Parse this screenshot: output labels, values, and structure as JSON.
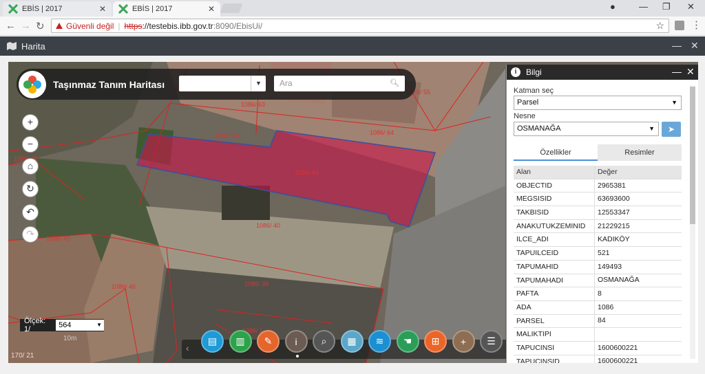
{
  "browser": {
    "tabs": [
      {
        "title": "EBİS | 2017"
      },
      {
        "title": "EBİS | 2017"
      }
    ],
    "security_label": "Güvenli değil",
    "url_scheme": "https",
    "url_host": "://testebis.ibb.gov.tr",
    "url_rest": ":8090/EbisUi/"
  },
  "app": {
    "header_title": "Harita",
    "map_title": "Taşınmaz Tanım Haritası",
    "search_placeholder": "Ara",
    "scale_label": "Ölçek: 1/",
    "scale_value": "564",
    "scale_unit": "10m",
    "copyright": "170/ 21"
  },
  "parcel_labels": [
    "1086/ 63",
    "1086/ 55",
    "1086/ 34",
    "1086/ 64",
    "1086/ 84",
    "1086/ 40",
    "1086/ 45",
    "1086/ 46",
    "1086/ 39",
    "1086/ 35",
    "1086/ 1"
  ],
  "toolbar_tools": [
    {
      "name": "document-tool",
      "color": "#1e9ad6"
    },
    {
      "name": "building-tool",
      "color": "#2ca24b"
    },
    {
      "name": "tag-tool",
      "color": "#e4662b"
    },
    {
      "name": "info-tool",
      "color": "#6b5b52"
    },
    {
      "name": "search-map-tool",
      "color": "#555555"
    },
    {
      "name": "map-tool",
      "color": "#5aa7c9"
    },
    {
      "name": "layers-tool",
      "color": "#1c8fd3"
    },
    {
      "name": "select-tool",
      "color": "#2a9e59"
    },
    {
      "name": "add-tool",
      "color": "#ec6528"
    },
    {
      "name": "crosshair-tool",
      "color": "#8e6e52"
    },
    {
      "name": "list-tool",
      "color": "#555555"
    }
  ],
  "info_panel": {
    "title": "Bilgi",
    "layer_label": "Katman seç",
    "layer_value": "Parsel",
    "object_label": "Nesne",
    "object_value": "OSMANAĞA",
    "tab_properties": "Özellikler",
    "tab_images": "Resimler",
    "col_field": "Alan",
    "col_value": "Değer",
    "rows": [
      {
        "k": "OBJECTID",
        "v": "2965381"
      },
      {
        "k": "MEGSISID",
        "v": "63693600"
      },
      {
        "k": "TAKBISID",
        "v": "12553347"
      },
      {
        "k": "ANAKUTUKZEMINID",
        "v": "21229215"
      },
      {
        "k": "ILCE_ADI",
        "v": "KADIKÖY"
      },
      {
        "k": "TAPUILCEID",
        "v": "521"
      },
      {
        "k": "TAPUMAHID",
        "v": "149493"
      },
      {
        "k": "TAPUMAHADI",
        "v": "OSMANAĞA"
      },
      {
        "k": "PAFTA",
        "v": "8"
      },
      {
        "k": "ADA",
        "v": "1086"
      },
      {
        "k": "PARSEL",
        "v": "84"
      },
      {
        "k": "MALIKTIPI",
        "v": ""
      },
      {
        "k": "TAPUCINSI",
        "v": "1600600221"
      },
      {
        "k": "TAPUCINSID",
        "v": "1600600221"
      }
    ]
  }
}
